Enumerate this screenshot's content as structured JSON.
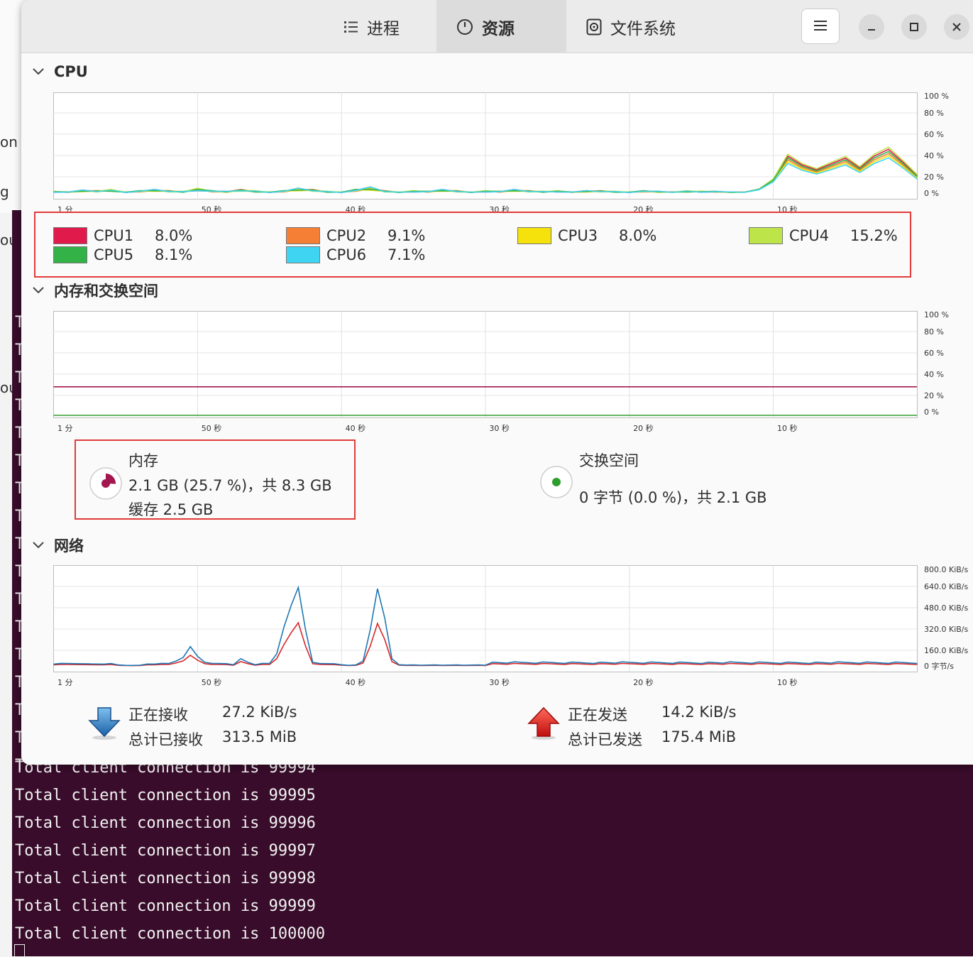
{
  "background": {
    "left_fragments": [
      "on",
      "g",
      "ou",
      "ou"
    ],
    "terminal": {
      "line_prefix_char": "T",
      "lines": [
        "Total client connection is 99994",
        "Total client connection is 99995",
        "Total client connection is 99996",
        "Total client connection is 99997",
        "Total client connection is 99998",
        "Total client connection is 99999",
        "Total client connection is 100000"
      ]
    }
  },
  "header": {
    "tabs": [
      {
        "label": "进程",
        "icon": "list-icon"
      },
      {
        "label": "资源",
        "icon": "gauge-icon",
        "active": true
      },
      {
        "label": "文件系统",
        "icon": "disk-icon"
      }
    ],
    "menu_icon": "hamburger-icon",
    "window_controls": [
      "minimize-icon",
      "maximize-icon",
      "close-icon"
    ]
  },
  "sections": {
    "cpu": "CPU",
    "memory": "内存和交换空间",
    "network": "网络"
  },
  "time_axis": [
    "1 分",
    "50 秒",
    "40 秒",
    "30 秒",
    "20 秒",
    "10 秒"
  ],
  "percent_axis": [
    "100 %",
    "80 %",
    "60 %",
    "40 %",
    "20 %",
    "0 %"
  ],
  "net_axis": [
    "800.0 KiB/s",
    "640.0 KiB/s",
    "480.0 KiB/s",
    "320.0 KiB/s",
    "160.0 KiB/s",
    "0 字节/s"
  ],
  "cpus": [
    {
      "name": "CPU1",
      "value": "8.0%",
      "color": "#e01b4c"
    },
    {
      "name": "CPU2",
      "value": "9.1%",
      "color": "#f57f35"
    },
    {
      "name": "CPU3",
      "value": "8.0%",
      "color": "#f5e20c"
    },
    {
      "name": "CPU4",
      "value": "15.2%",
      "color": "#bde54a"
    },
    {
      "name": "CPU5",
      "value": "8.1%",
      "color": "#33b248"
    },
    {
      "name": "CPU6",
      "value": "7.1%",
      "color": "#3fd5f2"
    }
  ],
  "memory": {
    "title": "内存",
    "usage": "2.1 GB (25.7 %)，共 8.3 GB",
    "cache": "缓存 2.5 GB",
    "percent": 25.7,
    "color": "#a3174e"
  },
  "swap": {
    "title": "交换空间",
    "usage": "0 字节 (0.0 %)，共 2.1 GB",
    "percent": 0.0,
    "color": "#2e9e2e"
  },
  "network": {
    "receiving_label": "正在接收",
    "receiving_value": "27.2 KiB/s",
    "total_received_label": "总计已接收",
    "total_received_value": "313.5 MiB",
    "sending_label": "正在发送",
    "sending_value": "14.2 KiB/s",
    "total_sent_label": "总计已发送",
    "total_sent_value": "175.4 MiB",
    "receive_color": "#1f77b4",
    "send_color": "#d62728"
  }
}
